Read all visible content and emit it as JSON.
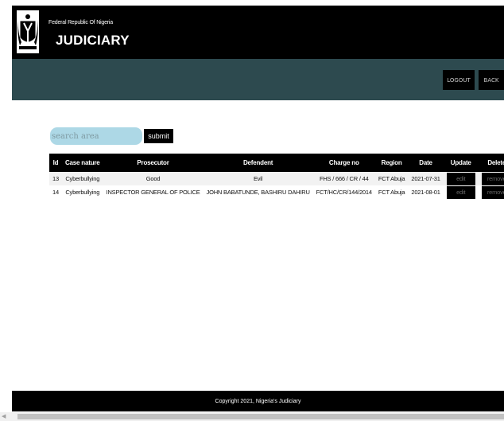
{
  "header": {
    "country": "Federal Republic Of Nigeria",
    "brand": "JUDICIARY"
  },
  "nav": {
    "logout": "LOGOUT",
    "back": "BACK"
  },
  "search": {
    "placeholder": "search area",
    "submit": "submit"
  },
  "table": {
    "headers": [
      "Id",
      "Case nature",
      "Prosecutor",
      "Defendent",
      "Charge no",
      "Region",
      "Date",
      "Update",
      "Delete"
    ],
    "rows": [
      {
        "id": "13",
        "case_nature": "Cyberbullying",
        "prosecutor": "Good",
        "defendent": "Evil",
        "charge_no": "FHS / 666 / CR / 44",
        "region": "FCT Abuja",
        "date": "2021-07-31",
        "update": "edit",
        "delete": "remove"
      },
      {
        "id": "14",
        "case_nature": "Cyberbullying",
        "prosecutor": "INSPECTOR GENERAL OF POLICE",
        "defendent": "JOHN BABATUNDE, BASHIRU DAHIRU",
        "charge_no": "FCT/HC/CR/144/2014",
        "region": "FCT Abuja",
        "date": "2021-08-01",
        "update": "edit",
        "delete": "remove"
      }
    ]
  },
  "footer": {
    "copyright": "Copyright 2021, Nigeria's Judiciary"
  },
  "colors": {
    "header_bg": "#000000",
    "nav_bg": "#2d4a4f",
    "search_bg": "#add8e6"
  },
  "icons": {
    "logo": "nigeria-coat-of-arms-icon",
    "scroll_left": "scroll-left-arrow-icon"
  }
}
